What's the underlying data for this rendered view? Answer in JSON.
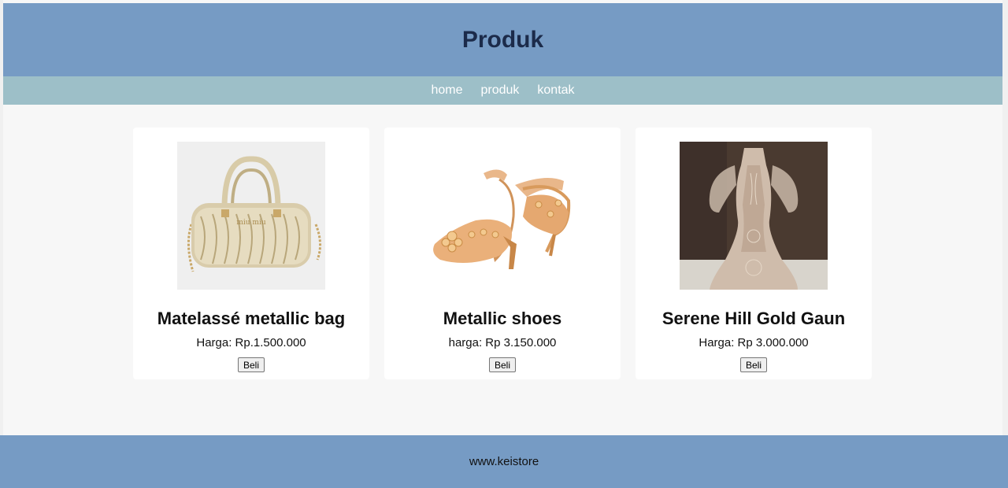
{
  "header": {
    "title": "Produk"
  },
  "nav": {
    "items": [
      "home",
      "produk",
      "kontak"
    ]
  },
  "products": [
    {
      "name": "Matelassé metallic bag",
      "price": "Harga: Rp.1.500.000",
      "button": "Beli",
      "icon": "handbag-image"
    },
    {
      "name": "Metallic shoes",
      "price": "harga: Rp 3.150.000",
      "button": "Beli",
      "icon": "heels-image"
    },
    {
      "name": "Serene Hill Gold Gaun",
      "price": "Harga: Rp 3.000.000",
      "button": "Beli",
      "icon": "gown-image"
    }
  ],
  "footer": {
    "text": "www.keistore"
  },
  "colors": {
    "header": "#769bc4",
    "nav": "#9dbfc8",
    "footer": "#769bc4",
    "background": "#f7f7f7"
  }
}
